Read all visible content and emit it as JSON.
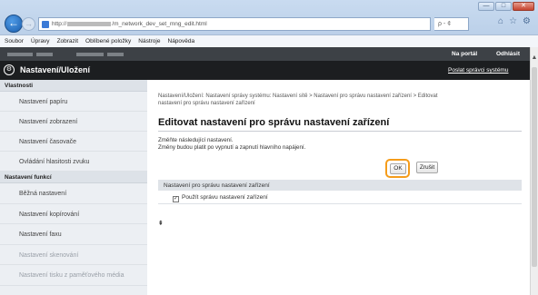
{
  "browser": {
    "address": {
      "prefix": "http://",
      "path": "/m_network_dev_set_mng_edit.html",
      "tools_label": "ρ - ¢"
    },
    "window_controls": [
      "—",
      "□",
      "✕"
    ],
    "menu": [
      "Soubor",
      "Úpravy",
      "Zobrazit",
      "Oblíbené položky",
      "Nástroje",
      "Nápověda"
    ]
  },
  "header": {
    "portal_link": "Na portál",
    "logout_link": "Odhlásit",
    "page_title": "Nastavení/Uložení",
    "mail_link": "Poslat správci systému"
  },
  "sidebar": {
    "section1_title": "Vlastnosti",
    "section1_items": [
      "Nastavení papíru",
      "Nastavení zobrazení",
      "Nastavení časovače",
      "Ovládání hlasitosti zvuku"
    ],
    "section2_title": "Nastavení funkcí",
    "section2_items": [
      "Běžná nastavení",
      "Nastavení kopírování",
      "Nastavení faxu",
      "Nastavení skenování",
      "Nastavení tisku z paměťového média"
    ]
  },
  "main": {
    "breadcrumb_line1": "Nastavení/Uložení: Nastavení správy systému: Nastavení sítě > Nastavení pro správu nastavení zařízení > Editovat",
    "breadcrumb_line2": "nastavení pro správu nastavení zařízení",
    "title": "Editovat nastavení pro správu nastavení zařízení",
    "instruction_line1": "Změňte následující nastavení.",
    "instruction_line2": "Změny budou platit po vypnutí a zapnutí hlavního napájení.",
    "ok_label": "OK",
    "cancel_label": "Zrušit",
    "section_heading": "Nastavení pro správu nastavení zařízení",
    "checkbox_label": "Použít správu nastavení zařízení",
    "checkbox_checked": true,
    "to_top_glyph": "⇞"
  },
  "colors": {
    "title_bar": "#1c1e20",
    "header_strip": "#3d4146",
    "highlight": "#f59c1a",
    "sidebar_bg": "#eceff3"
  }
}
